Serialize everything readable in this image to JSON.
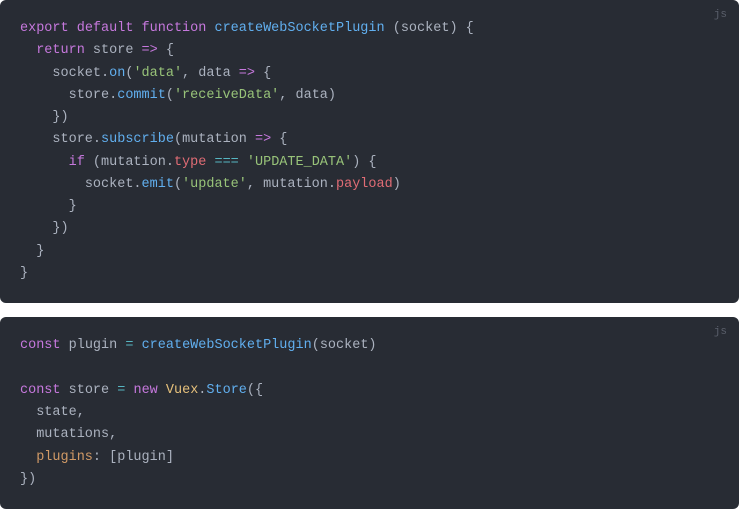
{
  "block1": {
    "lang": "js",
    "l1_export": "export",
    "l1_default": "default",
    "l1_function": "function",
    "l1_fname": "createWebSocketPlugin",
    "l1_param": "socket",
    "l2_return": "return",
    "l2_store": "store",
    "l2_arrow": "=>",
    "l3_socket": "socket",
    "l3_on": "on",
    "l3_str_data": "'data'",
    "l3_data": "data",
    "l3_arrow": "=>",
    "l4_store": "store",
    "l4_commit": "commit",
    "l4_str_receive": "'receiveData'",
    "l4_data": "data",
    "l6_store": "store",
    "l6_subscribe": "subscribe",
    "l6_mutation": "mutation",
    "l6_arrow": "=>",
    "l7_if": "if",
    "l7_mutation": "mutation",
    "l7_type": "type",
    "l7_eq": "===",
    "l7_str_update": "'UPDATE_DATA'",
    "l8_socket": "socket",
    "l8_emit": "emit",
    "l8_str_update": "'update'",
    "l8_mutation": "mutation",
    "l8_payload": "payload"
  },
  "block2": {
    "lang": "js",
    "l1_const": "const",
    "l1_plugin": "plugin",
    "l1_fn": "createWebSocketPlugin",
    "l1_socket": "socket",
    "l3_const": "const",
    "l3_store": "store",
    "l3_new": "new",
    "l3_vuex": "Vuex",
    "l3_Store": "Store",
    "l4_state": "state",
    "l5_mutations": "mutations",
    "l6_plugins": "plugins",
    "l6_plugin": "plugin"
  }
}
